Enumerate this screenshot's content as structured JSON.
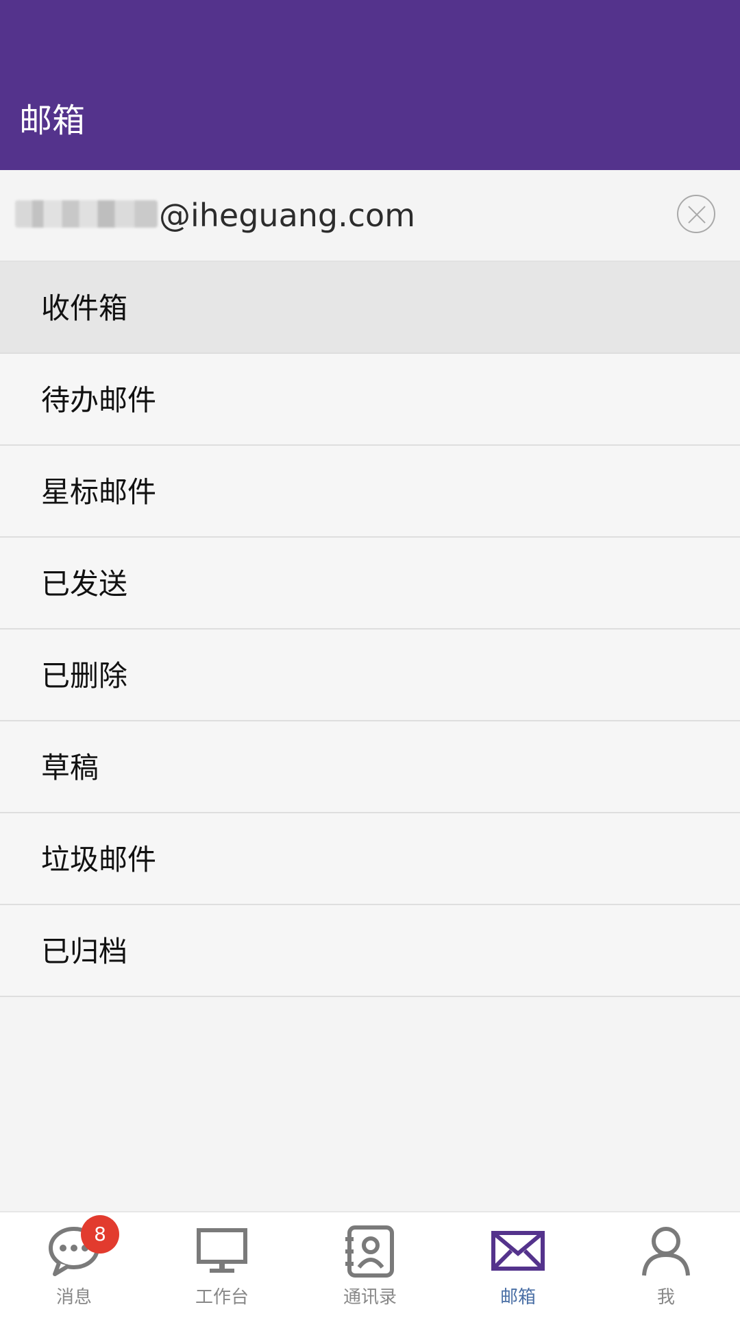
{
  "header": {
    "title": "邮箱"
  },
  "account": {
    "email_suffix": "@iheguang.com"
  },
  "folders": [
    {
      "label": "收件箱",
      "active": true
    },
    {
      "label": "待办邮件"
    },
    {
      "label": "星标邮件"
    },
    {
      "label": "已发送"
    },
    {
      "label": "已删除"
    },
    {
      "label": "草稿"
    },
    {
      "label": "垃圾邮件"
    },
    {
      "label": "已归档"
    }
  ],
  "tabbar": {
    "items": [
      {
        "label": "消息",
        "icon": "chat-icon",
        "badge": "8"
      },
      {
        "label": "工作台",
        "icon": "monitor-icon"
      },
      {
        "label": "通讯录",
        "icon": "contacts-icon"
      },
      {
        "label": "邮箱",
        "icon": "mail-icon",
        "active": true
      },
      {
        "label": "我",
        "icon": "person-icon"
      }
    ]
  },
  "colors": {
    "header": "#54338c",
    "active_tab": "#4a6fa5",
    "badge": "#e23b2e"
  }
}
